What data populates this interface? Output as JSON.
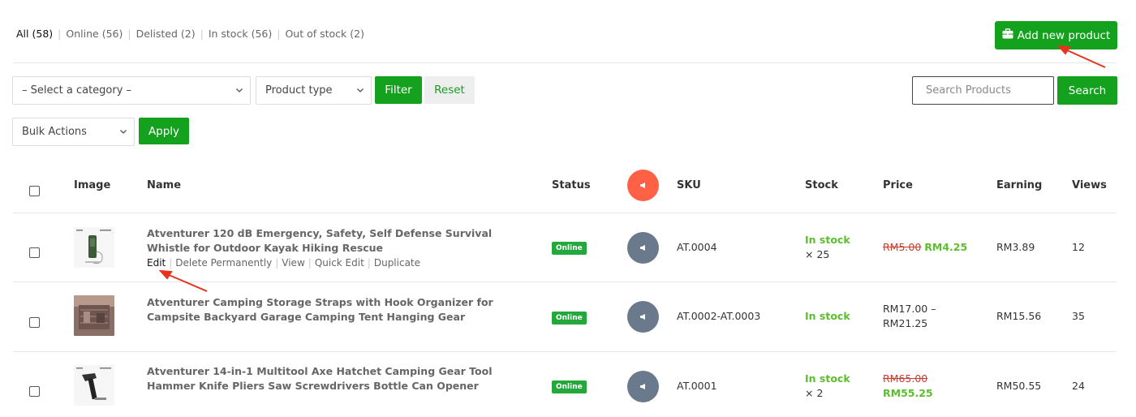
{
  "filters": [
    {
      "label": "All",
      "count": "(58)",
      "active": true
    },
    {
      "label": "Online",
      "count": "(56)"
    },
    {
      "label": "Delisted",
      "count": "(2)"
    },
    {
      "label": "In stock",
      "count": "(56)"
    },
    {
      "label": "Out of stock",
      "count": "(2)"
    }
  ],
  "toolbar": {
    "add_product": "Add new product",
    "category_select": "– Select a category –",
    "product_type_select": "Product type",
    "filter": "Filter",
    "reset": "Reset",
    "search_placeholder": "Search Products",
    "search": "Search",
    "bulk_actions": "Bulk Actions",
    "apply": "Apply"
  },
  "table": {
    "headers": {
      "image": "Image",
      "name": "Name",
      "status": "Status",
      "sku": "SKU",
      "stock": "Stock",
      "price": "Price",
      "earning": "Earning",
      "views": "Views"
    },
    "row_actions": [
      "Edit",
      "Delete Permanently",
      "View",
      "Quick Edit",
      "Duplicate"
    ],
    "rows": [
      {
        "name": "Atventurer 120 dB Emergency, Safety, Self Defense Survival Whistle for Outdoor Kayak Hiking Rescue",
        "status": "Online",
        "sku": "AT.0004",
        "stock": "In stock",
        "stock_qty": "× 25",
        "price_old": "RM5.00",
        "price_new": "RM4.25",
        "earning": "RM3.89",
        "views": "12"
      },
      {
        "name": "Atventurer Camping Storage Straps with Hook Organizer for Campsite Backyard Garage Camping Tent Hanging Gear",
        "status": "Online",
        "sku": "AT.0002-AT.0003",
        "stock": "In stock",
        "price_range": "RM17.00 – RM21.25",
        "earning": "RM15.56",
        "views": "35"
      },
      {
        "name": "Atventurer 14-in-1 Multitool Axe Hatchet Camping Gear Tool Hammer Knife Pliers Saw Screwdrivers Bottle Can Opener",
        "status": "Online",
        "sku": "AT.0001",
        "stock": "In stock",
        "stock_qty": "× 2",
        "price_old": "RM65.00",
        "price_new": "RM55.25",
        "earning": "RM50.55",
        "views": "24"
      }
    ]
  },
  "colors": {
    "primary_green": "#13a11e",
    "stock_green": "#5cbe2d",
    "sale_red": "#d03a2a",
    "badge_green": "#23a93b",
    "annotation_arrow": "#e8321e",
    "promo_header": "#ff6147",
    "promo_row": "#6a7a8c"
  },
  "icons": [
    "briefcase-icon",
    "megaphone-icon",
    "chevron-down-icon"
  ]
}
